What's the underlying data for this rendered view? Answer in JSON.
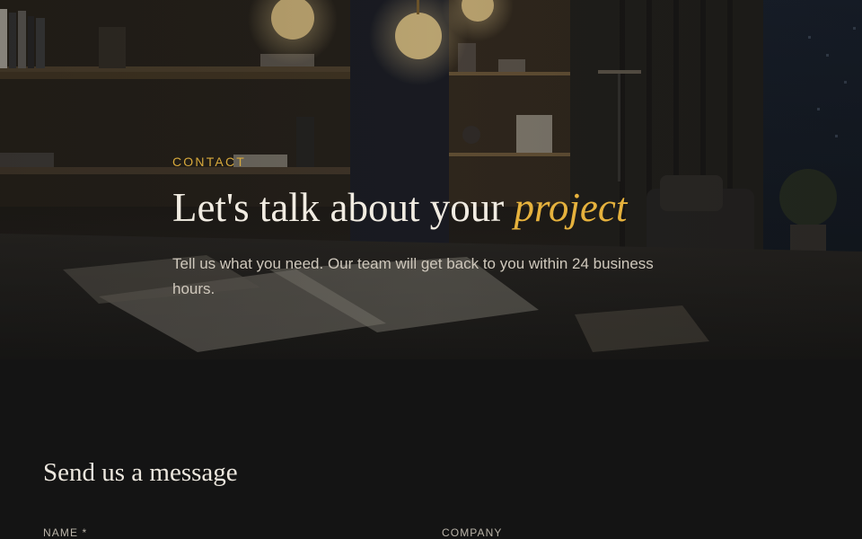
{
  "hero": {
    "eyebrow": "CONTACT",
    "title_main": "Let's talk about your ",
    "title_accent": "project",
    "subtitle": "Tell us what you need. Our team will get back to you within 24 business hours."
  },
  "form": {
    "title": "Send us a message",
    "labels": {
      "name": "NAME *",
      "company": "COMPANY"
    }
  },
  "colors": {
    "accent": "#d8a93c",
    "background": "#141414",
    "text": "#ece7de"
  }
}
